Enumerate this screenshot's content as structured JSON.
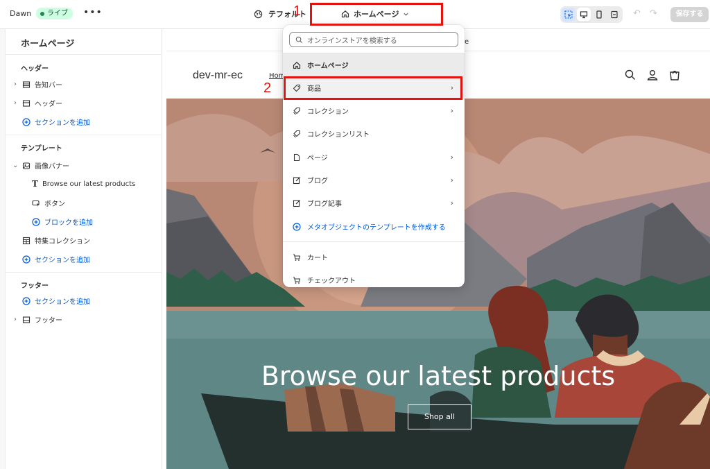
{
  "topbar": {
    "theme_name": "Dawn",
    "live_badge": "ライブ",
    "more": "•••",
    "default_label": "テフォルト",
    "template_label": "ホームページ",
    "save_label": "保存する"
  },
  "annotations": {
    "marker1": "1",
    "marker2": "2",
    "color": "#e3140f"
  },
  "sidebar": {
    "title": "ホームページ",
    "header_heading": "ヘッダー",
    "announcement_bar": "告知バー",
    "header_item": "ヘッダー",
    "add_section_1": "セクションを追加",
    "template_heading": "テンプレート",
    "image_banner": "画像バナー",
    "banner_text": "Browse our latest products",
    "banner_button": "ボタン",
    "add_block": "ブロックを追加",
    "featured_collection": "特集コレクション",
    "add_section_2": "セクションを追加",
    "footer_heading": "フッター",
    "add_section_3": "セクションを追加",
    "footer_item": "フッター"
  },
  "dropdown": {
    "search_placeholder": "オンラインストアを検索する",
    "items": [
      {
        "label": "ホームページ",
        "icon": "home-icon"
      },
      {
        "label": "商品",
        "icon": "tag-icon"
      },
      {
        "label": "コレクション",
        "icon": "collection-icon"
      },
      {
        "label": "コレクションリスト",
        "icon": "collection-list-icon"
      },
      {
        "label": "ページ",
        "icon": "page-icon"
      },
      {
        "label": "ブログ",
        "icon": "blog-icon"
      },
      {
        "label": "ブログ記事",
        "icon": "blog-post-icon"
      },
      {
        "label": "メタオブジェクトのテンプレートを作成する",
        "icon": "plus-circle-icon"
      },
      {
        "label": "カート",
        "icon": "cart-icon"
      },
      {
        "label": "チェックアウト",
        "icon": "checkout-icon"
      }
    ]
  },
  "preview": {
    "announcement_fragment": "ore",
    "store_name": "dev-mr-ec",
    "nav_home": "Hom",
    "hero_title": "Browse our latest products",
    "hero_button": "Shop all"
  },
  "colors": {
    "accent": "#005bd3",
    "live_bg": "#cdfee1",
    "annotation": "#e3140f"
  }
}
